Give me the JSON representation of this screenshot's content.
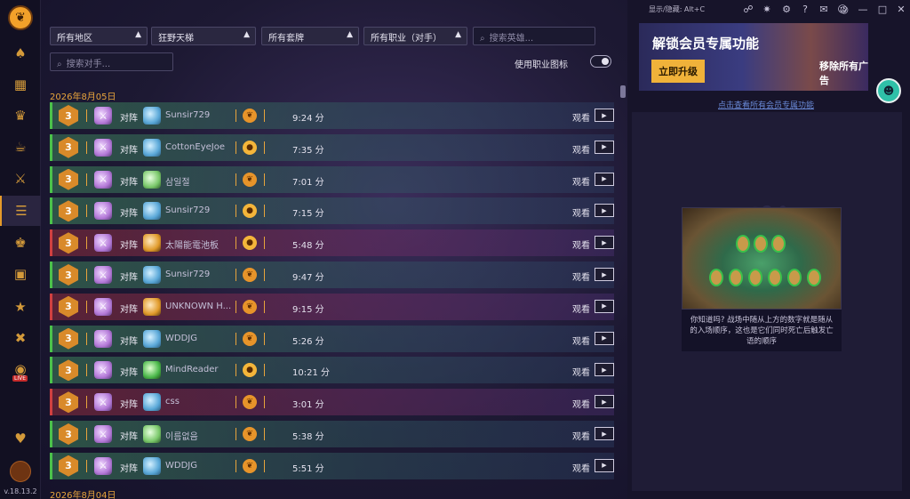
{
  "sidebar": {
    "logo": "flame-logo-icon",
    "items": [
      {
        "icon": "decks-icon",
        "active": false
      },
      {
        "icon": "collection-icon",
        "active": false
      },
      {
        "icon": "arena-icon",
        "active": false
      },
      {
        "icon": "tavern-icon",
        "active": false
      },
      {
        "icon": "battlegrounds-icon",
        "active": false
      },
      {
        "icon": "match-history-icon",
        "active": true
      },
      {
        "icon": "crown-icon",
        "active": false
      },
      {
        "icon": "treasure-icon",
        "active": false
      },
      {
        "icon": "achievement-icon",
        "active": false
      },
      {
        "icon": "crossed-swords-icon",
        "active": false
      },
      {
        "icon": "live-icon",
        "active": false,
        "badge": "LIVE"
      },
      {
        "icon": "heart-hand-icon",
        "active": false
      }
    ],
    "version": "v.18.13.2"
  },
  "filters": {
    "region": "所有地区",
    "mode": "狂野天梯",
    "deck": "所有套牌",
    "opponent_class": "所有职业（对手）",
    "hero_search_placeholder": "搜索英雄...",
    "opponent_search_placeholder": "搜索对手...",
    "class_icon_toggle_label": "使用职业图标",
    "class_icon_toggle_on": true
  },
  "groups": [
    {
      "date": "2026年8月05日",
      "matches": [
        {
          "result": "win",
          "rank": "3",
          "vs": "对阵",
          "opponent": "Sunsir729",
          "opp_class": "shaman",
          "coin": "first",
          "duration": "9:24 分",
          "watch": "观看"
        },
        {
          "result": "win",
          "rank": "3",
          "vs": "对阵",
          "opponent": "CottonEyeJoe",
          "opp_class": "shaman",
          "coin": "second",
          "duration": "7:35 分",
          "watch": "观看"
        },
        {
          "result": "win",
          "rank": "3",
          "vs": "对阵",
          "opponent": "삼일절",
          "opp_class": "rogue",
          "coin": "first",
          "duration": "7:01 分",
          "watch": "观看"
        },
        {
          "result": "win",
          "rank": "3",
          "vs": "对阵",
          "opponent": "Sunsir729",
          "opp_class": "shaman",
          "coin": "second",
          "duration": "7:15 分",
          "watch": "观看"
        },
        {
          "result": "loss",
          "rank": "3",
          "vs": "对阵",
          "opponent": "太陽能電池板",
          "opp_class": "dh",
          "coin": "second",
          "duration": "5:48 分",
          "watch": "观看"
        },
        {
          "result": "win",
          "rank": "3",
          "vs": "对阵",
          "opponent": "Sunsir729",
          "opp_class": "shaman",
          "coin": "first",
          "duration": "9:47 分",
          "watch": "观看"
        },
        {
          "result": "loss",
          "rank": "3",
          "vs": "对阵",
          "opponent": "UNKNOWN H...",
          "opp_class": "dh",
          "coin": "first",
          "duration": "9:15 分",
          "watch": "观看"
        },
        {
          "result": "win",
          "rank": "3",
          "vs": "对阵",
          "opponent": "WDDJG",
          "opp_class": "shaman",
          "coin": "first",
          "duration": "5:26 分",
          "watch": "观看"
        },
        {
          "result": "win",
          "rank": "3",
          "vs": "对阵",
          "opponent": "MindReader",
          "opp_class": "mage",
          "coin": "second",
          "duration": "10:21 分",
          "watch": "观看"
        },
        {
          "result": "loss",
          "rank": "3",
          "vs": "对阵",
          "opponent": "css",
          "opp_class": "shaman",
          "coin": "first",
          "duration": "3:01 分",
          "watch": "观看"
        },
        {
          "result": "win",
          "rank": "3",
          "vs": "对阵",
          "opponent": "이름없음",
          "opp_class": "rogue",
          "coin": "first",
          "duration": "5:38 分",
          "watch": "观看"
        },
        {
          "result": "win",
          "rank": "3",
          "vs": "对阵",
          "opponent": "WDDJG",
          "opp_class": "shaman",
          "coin": "first",
          "duration": "5:51 分",
          "watch": "观看"
        }
      ]
    },
    {
      "date": "2026年8月04日",
      "matches": []
    }
  ],
  "titlebar": {
    "hotkey_hint": "显示/隐藏:  Alt+C",
    "icons": [
      "share-icon",
      "bug-icon",
      "settings-gear-icon",
      "help-icon",
      "gift-icon",
      "discord-icon",
      "globe-icon",
      "minimize-icon",
      "maximize-icon",
      "close-icon"
    ]
  },
  "promo": {
    "title": "解锁会员专属功能",
    "button": "立即升级",
    "subtitle": "移除所有广告",
    "member_link": "点击查看所有会员专属功能"
  },
  "tip": {
    "text": "你知道吗? 战场中随从上方的数字就是随从的入场顺序，这也是它们同时死亡后触发亡语的顺序"
  },
  "colors": {
    "accent": "#e8a43c",
    "win_stripe": "#4bc24b",
    "loss_stripe": "#d04040",
    "link": "#6a8ad8"
  }
}
